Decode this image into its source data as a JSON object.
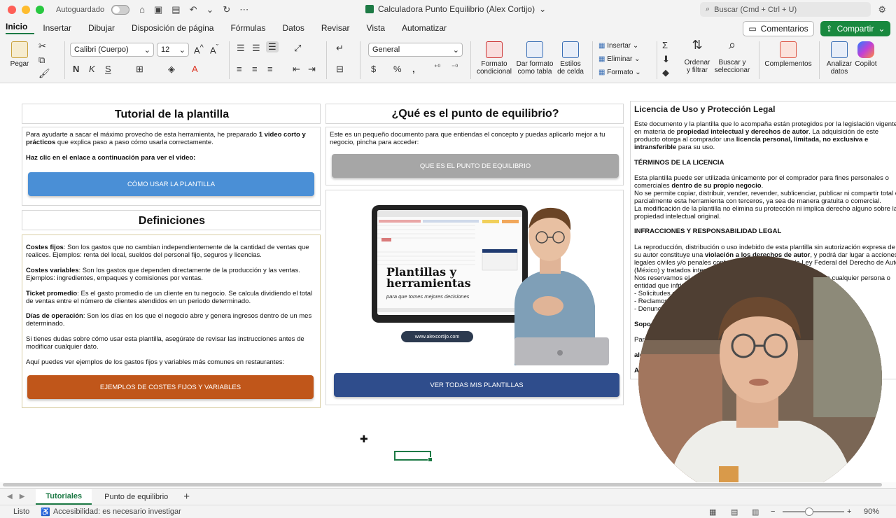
{
  "titlebar": {
    "autosave_label": "Autoguardado",
    "doc_title": "Calculadora Punto Equilibrio (Alex Cortijo)",
    "search_placeholder": "Buscar (Cmd + Ctrl + U)"
  },
  "menu": [
    "Inicio",
    "Insertar",
    "Dibujar",
    "Disposición de página",
    "Fórmulas",
    "Datos",
    "Revisar",
    "Vista",
    "Automatizar"
  ],
  "menu_active": "Inicio",
  "actions": {
    "comments": "Comentarios",
    "share": "Compartir"
  },
  "ribbon": {
    "paste": "Pegar",
    "font_name": "Calibri (Cuerpo)",
    "font_size": "12",
    "number_format": "General",
    "cond_format": [
      "Formato",
      "condicional"
    ],
    "format_table": [
      "Dar formato",
      "como tabla"
    ],
    "cell_styles": [
      "Estilos",
      "de celda"
    ],
    "insert": "Insertar",
    "delete": "Eliminar",
    "format": "Formato",
    "sort_filter": [
      "Ordenar",
      "y filtrar"
    ],
    "find_select": [
      "Buscar y",
      "seleccionar"
    ],
    "addins": "Complementos",
    "analyze": [
      "Analizar",
      "datos"
    ],
    "copilot": "Copilot"
  },
  "tutorial": {
    "title": "Tutorial de la plantilla",
    "intro_pre": "Para ayudarte a sacar el máximo provecho de esta herramienta, he preparado ",
    "intro_bold": "1 video corto y prácticos",
    "intro_post": " que explica paso a paso cómo usarla correctamente.",
    "click_note": "Haz clic en el enlace a continuación para ver el video:",
    "button": "CÓMO USAR LA PLANTILLA"
  },
  "definitions": {
    "title": "Definiciones",
    "items": [
      {
        "term": "Costes fijos",
        "text": ": Son los gastos que no cambian independientemente de la cantidad de ventas que realices. Ejemplos: renta del local, sueldos del personal fijo, seguros y licencias."
      },
      {
        "term": "Costes variables",
        "text": ": Son los gastos que dependen directamente de la producción y las ventas. Ejemplos: ingredientes, empaques y comisiones por ventas."
      },
      {
        "term": "Ticket promedio",
        "text": ": Es el gasto promedio de un cliente en tu negocio. Se calcula dividiendo el total de ventas entre el número de clientes atendidos en un periodo determinado."
      },
      {
        "term": "Días de operación",
        "text": ": Son los días en los que el negocio abre y genera ingresos dentro de un mes determinado."
      }
    ],
    "note": "Si tienes dudas sobre cómo usar esta plantilla, asegúrate de revisar las instrucciones antes de modificar cualquier dato.",
    "examples_note": "Aquí puedes ver ejemplos de los gastos fijos y variables más comunes en restaurantes:",
    "button": "EJEMPLOS DE COSTES FIJOS Y VARIABLES"
  },
  "breakeven": {
    "title": "¿Qué es el punto de equilibrio?",
    "text": "Este es un pequeño documento para que entiendas el concepto y puedas aplicarlo mejor a tu negocio, pincha para acceder:",
    "button": "QUE ES EL PUNTO DE EQUILIBRIO"
  },
  "promo": {
    "headline": "Plantillas y herramientas",
    "tagline": "para que tomes mejores decisiones",
    "website": "www.alexcortijo.com",
    "button": "VER TODAS MIS PLANTILLAS"
  },
  "license": {
    "title": "Licencia de Uso y Protección Legal",
    "p1_pre": "Este documento y la plantilla que lo acompaña están protegidos por la legislación vigente en materia de ",
    "p1_bold1": "propiedad intelectual y derechos de autor",
    "p1_mid": ". La adquisición de este producto otorga al comprador una ",
    "p1_bold2": "licencia personal, limitada, no exclusiva e intransferible",
    "p1_post": " para su uso.",
    "terms_title": "TÉRMINOS DE LA LICENCIA",
    "t1_pre": "Esta plantilla puede ser utilizada únicamente por el comprador para fines personales o comerciales ",
    "t1_bold": "dentro de su propio negocio",
    "t1_post": ".",
    "t2": "No se permite copiar, distribuir, vender, revender, sublicenciar, publicar ni compartir total o parcialmente esta herramienta con terceros, ya sea de manera gratuita o comercial.",
    "t3": "La modificación de la plantilla no elimina su protección ni implica derecho alguno sobre la propiedad intelectual original.",
    "infr_title": "INFRACCIONES Y RESPONSABILIDAD LEGAL",
    "i1_pre": "La reproducción, distribución o uso indebido de esta plantilla sin autorización expresa de su autor constituye una ",
    "i1_bold": "violación a los derechos de autor",
    "i1_post": ", y podrá dar lugar a acciones legales civiles y/o penales conforme a lo dispuesto en la Ley Federal del Derecho de Autor (México) y tratados internacionales.",
    "i2": "Nos reservamos el derecho de emprender acciones legales contra cualquier persona o entidad que infrinja esta licencia, incluyendo:",
    "list": [
      "- Solicitudes de retiro",
      "- Reclamos",
      "- Denuncias"
    ],
    "support_title": "Soporte",
    "support_line": "Para",
    "email_fragment": "ale",
    "last_fragment": "A"
  },
  "sheet_tabs": [
    "Tutoriales",
    "Punto de equilibrio"
  ],
  "sheet_tab_active": "Tutoriales",
  "status": {
    "ready": "Listo",
    "accessibility": "Accesibilidad: es necesario investigar",
    "zoom": "90%"
  },
  "colors": {
    "excel_green": "#1d7a45",
    "btn_blue": "#4a8fd6",
    "btn_gray": "#a6a6a6",
    "btn_orange": "#c0561a",
    "btn_navy": "#2f4d8c"
  }
}
